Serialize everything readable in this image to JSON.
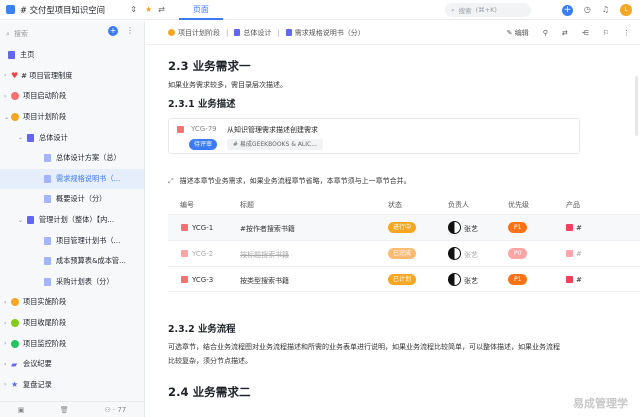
{
  "topbar": {
    "space_title": "# 交付型项目知识空间",
    "tab_label": "页面",
    "search_placeholder": "搜索",
    "search_shortcut": "(⌘+K)",
    "avatar_text": "L"
  },
  "sidebar": {
    "search_placeholder": "搜索",
    "home_label": "主页",
    "items": [
      {
        "label": "# 项目管理制度",
        "color": "#ef4444"
      },
      {
        "label": "项目启动阶段",
        "color": "#f87171"
      },
      {
        "label": "项目计划阶段",
        "color": "#f5a623"
      },
      {
        "label": "总体设计",
        "color": "#6366f1"
      },
      {
        "label": "总体设计方案（总）",
        "color": "#6366f1"
      },
      {
        "label": "需求规格说明书（...",
        "color": "#6366f1"
      },
      {
        "label": "概要设计（分）",
        "color": "#6366f1"
      },
      {
        "label": "管理计划（整体）【内...",
        "color": "#6366f1"
      },
      {
        "label": "项目管理计划书（...",
        "color": "#6366f1"
      },
      {
        "label": "成本预算表&成本管...",
        "color": "#6366f1"
      },
      {
        "label": "采购计划表（分）",
        "color": "#6366f1"
      },
      {
        "label": "项目实施阶段",
        "color": "#f5a623"
      },
      {
        "label": "项目收尾阶段",
        "color": "#84cc16"
      },
      {
        "label": "项目监控阶段",
        "color": "#22c55e"
      },
      {
        "label": "会议纪要",
        "color": "#6366f1"
      },
      {
        "label": "复盘记录",
        "color": "#6366f1"
      }
    ],
    "member_count": "77"
  },
  "breadcrumb": {
    "items": [
      "项目计划阶段",
      "总体设计",
      "需求规格说明书（分）"
    ],
    "edit_label": "编辑"
  },
  "doc": {
    "h2_1": "2.3  业务需求一",
    "intro": "如果业务需求较多，需目录层次描述。",
    "h3_1": "2.3.1  业务描述",
    "card": {
      "id": "YCG-79",
      "title": "从知识管理需求描述创建需求",
      "status": "待评审",
      "tag": "# 易成GEEKBOOKS & ALIC..."
    },
    "quote": "描述本章节业务需求，如果业务流程章节省略，本章节须与上一章节合并。",
    "table": {
      "headers": [
        "编号",
        "标题",
        "状态",
        "负责人",
        "优先级",
        "产品"
      ],
      "rows": [
        {
          "id": "YCG-1",
          "title": "#按作者搜索书籍",
          "status": "进行中",
          "status_color": "#f5a623",
          "owner": "张艺",
          "priority": "P1",
          "priority_color": "#f97316",
          "product": "#"
        },
        {
          "id": "YCG-2",
          "title": "按标题搜索书籍",
          "status": "已完成",
          "status_color": "#fdba74",
          "owner": "张艺",
          "priority": "P0",
          "priority_color": "#fca5a5",
          "product": "#"
        },
        {
          "id": "YCG-3",
          "title": "按类型搜索书籍",
          "status": "已计划",
          "status_color": "#f5a623",
          "owner": "张艺",
          "priority": "P1",
          "priority_color": "#f97316",
          "product": "#"
        }
      ]
    },
    "h3_2": "2.3.2   业务流程",
    "para2_line1": "可选章节，结合业务流程图对业务流程描述和所需的业务表单进行说明，如果业务流程比较简单，可以整体描述，如果业务流程",
    "para2_line2": "比较复杂，须分节点描述。",
    "h2_2": "2.4  业务需求二"
  },
  "watermark": "易成管理学"
}
